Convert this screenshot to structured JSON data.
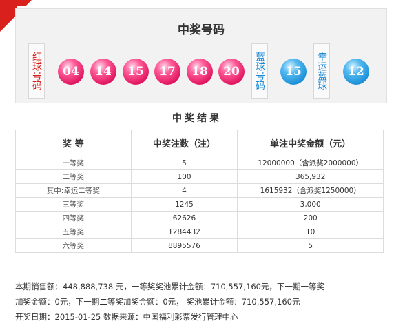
{
  "winning_numbers": {
    "title": "中奖号码",
    "red_label": "红球号码",
    "blue_label": "蓝球号码",
    "lucky_label": "幸运蓝球",
    "red_balls": [
      "04",
      "14",
      "15",
      "17",
      "18",
      "20"
    ],
    "blue_ball": "15",
    "lucky_blue_ball": "12"
  },
  "results": {
    "title": "中奖结果",
    "headers": [
      "奖 等",
      "中奖注数（注）",
      "单注中奖金额（元）"
    ],
    "rows": [
      {
        "name": "一等奖",
        "count": "5",
        "amount": "12000000（含派奖2000000）"
      },
      {
        "name": "二等奖",
        "count": "100",
        "amount": "365,932"
      },
      {
        "name": "其中:幸运二等奖",
        "count": "4",
        "amount": "1615932（含派奖1250000）"
      },
      {
        "name": "三等奖",
        "count": "1245",
        "amount": "3,000"
      },
      {
        "name": "四等奖",
        "count": "62626",
        "amount": "200"
      },
      {
        "name": "五等奖",
        "count": "1284432",
        "amount": "10"
      },
      {
        "name": "六等奖",
        "count": "8895576",
        "amount": "5"
      }
    ]
  },
  "summary": {
    "line1": "本期销售额：448,888,738 元，一等奖奖池累计金额：710,557,160元，下一期一等奖",
    "line2": "加奖金额：0元，下一期二等奖加奖金额：0元， 奖池累计金额：710,557,160元",
    "line3": "开奖日期：2015-01-25 数据来源：中国福利彩票发行管理中心"
  },
  "colors": {
    "accent_red": "#d9201c",
    "ball_red": "#e0135d",
    "ball_blue": "#1a8fd6",
    "label_blue": "#1d8ad6"
  }
}
